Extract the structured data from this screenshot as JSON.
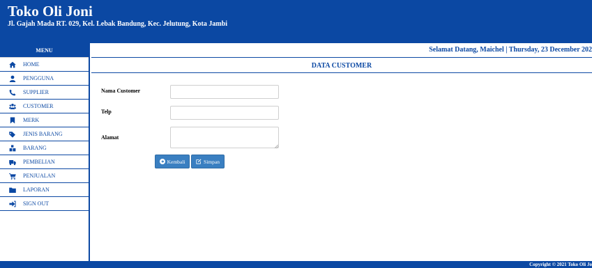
{
  "header": {
    "title": "Toko Oli Joni",
    "address": "Jl. Gajah Mada RT. 029, Kel. Lebak Bandung, Kec. Jelutung, Kota Jambi"
  },
  "sidebar": {
    "title": "MENU",
    "items": [
      {
        "label": "HOME",
        "icon": "home-icon"
      },
      {
        "label": "PENGGUNA",
        "icon": "user-icon"
      },
      {
        "label": "SUPPLIER",
        "icon": "phone-icon"
      },
      {
        "label": "CUSTOMER",
        "icon": "users-icon"
      },
      {
        "label": "MERK",
        "icon": "bookmark-icon"
      },
      {
        "label": "JENIS BARANG",
        "icon": "tags-icon"
      },
      {
        "label": "BARANG",
        "icon": "cubes-icon"
      },
      {
        "label": "PEMBELIAN",
        "icon": "truck-icon"
      },
      {
        "label": "PENJUALAN",
        "icon": "cart-icon"
      },
      {
        "label": "LAPORAN",
        "icon": "folder-icon"
      },
      {
        "label": "SIGN OUT",
        "icon": "sign-out-icon"
      }
    ]
  },
  "topbar": {
    "welcome": "Selamat Datang, Maichel | Thursday, 23 December 202"
  },
  "page": {
    "title": "DATA CUSTOMER"
  },
  "form": {
    "nama_label": "Nama Customer",
    "nama_value": "",
    "telp_label": "Telp",
    "telp_value": "",
    "alamat_label": "Alamat",
    "alamat_value": "",
    "back_label": "Kembali",
    "save_label": "Simpan"
  },
  "footer": {
    "text": "Copyright © 2021 Toko Oli Jo"
  },
  "colors": {
    "primary": "#0b48a3",
    "button": "#3a7fc1"
  }
}
